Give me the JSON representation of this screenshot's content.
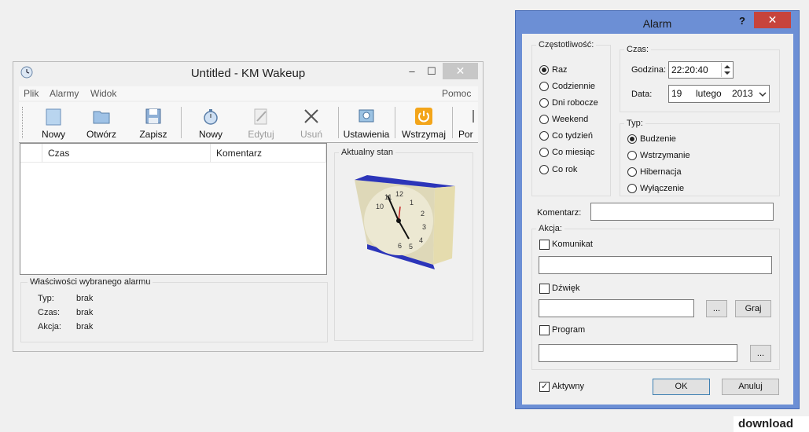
{
  "main": {
    "title": "Untitled - KM Wakeup",
    "controls": {
      "minimize": "–",
      "maximize": "☐",
      "close": "✕"
    },
    "menu": [
      "Plik",
      "Alarmy",
      "Widok"
    ],
    "menu_right": "Pomoc",
    "toolbar": [
      "Nowy",
      "Otwórz",
      "Zapisz",
      "Nowy",
      "Edytuj",
      "Usuń",
      "Ustawienia",
      "Wstrzymaj",
      "Por"
    ],
    "columns": [
      "Czas",
      "Komentarz"
    ],
    "status_group": "Aktualny stan",
    "props_group": "Właściwości wybranego alarmu",
    "props": [
      {
        "label": "Typ:",
        "value": "brak"
      },
      {
        "label": "Czas:",
        "value": "brak"
      },
      {
        "label": "Akcja:",
        "value": "brak"
      }
    ]
  },
  "dialog": {
    "title": "Alarm",
    "help": "?",
    "close": "✕",
    "frequency_group": "Częstotliwość:",
    "frequency": [
      "Raz",
      "Codziennie",
      "Dni robocze",
      "Weekend",
      "Co tydzień",
      "Co miesiąc",
      "Co rok"
    ],
    "time_group": "Czas:",
    "hour_label": "Godzina:",
    "hour_value": "22:20:40",
    "date_label": "Data:",
    "date_day": "19",
    "date_month": "lutego",
    "date_year": "2013",
    "type_group": "Typ:",
    "types": [
      "Budzenie",
      "Wstrzymanie",
      "Hibernacja",
      "Wyłączenie"
    ],
    "comment_label": "Komentarz:",
    "action_group": "Akcja:",
    "message_label": "Komunikat",
    "sound_label": "Dźwięk",
    "browse": "...",
    "play": "Graj",
    "program_label": "Program",
    "active_label": "Aktywny",
    "active_check": "✓",
    "ok": "OK",
    "cancel": "Anuluj"
  },
  "watermark": "download"
}
